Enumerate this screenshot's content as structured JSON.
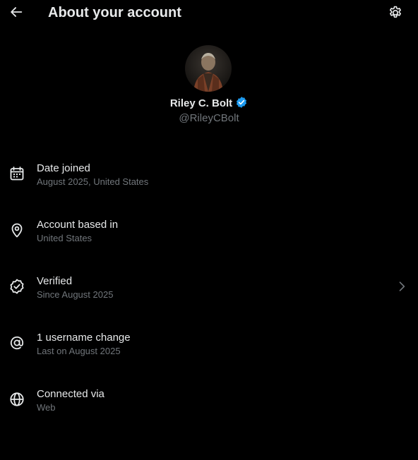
{
  "header": {
    "title": "About your account",
    "back_icon": "arrow-left-icon",
    "settings_icon": "gear-icon"
  },
  "profile": {
    "display_name": "Riley C. Bolt",
    "handle": "@RileyCBolt",
    "verified": true,
    "verified_color": "#1d9bf0"
  },
  "info": {
    "items": [
      {
        "icon": "calendar-icon",
        "label": "Date joined",
        "sub": "August 2025, United States",
        "has_chevron": false
      },
      {
        "icon": "location-pin-icon",
        "label": "Account based in",
        "sub": "United States",
        "has_chevron": false
      },
      {
        "icon": "verified-badge-icon",
        "label": "Verified",
        "sub": "Since August 2025",
        "has_chevron": true
      },
      {
        "icon": "at-sign-icon",
        "label": "1 username change",
        "sub": "Last on August 2025",
        "has_chevron": false
      },
      {
        "icon": "globe-icon",
        "label": "Connected via",
        "sub": "Web",
        "has_chevron": false
      }
    ]
  },
  "colors": {
    "background": "#000000",
    "text_primary": "#e7e9ea",
    "text_secondary": "#71767b",
    "accent": "#1d9bf0"
  }
}
